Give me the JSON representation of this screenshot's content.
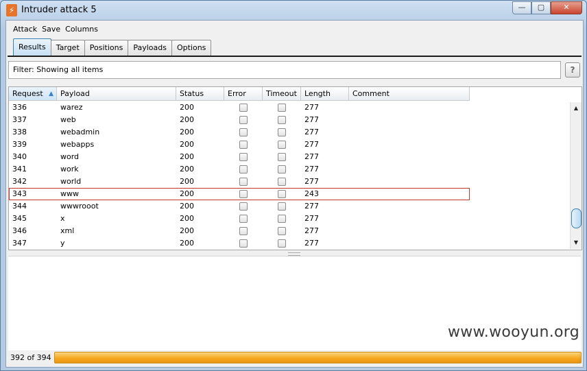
{
  "window": {
    "title": "Intruder attack 5",
    "minimize": "—",
    "maximize": "▢",
    "close": "✕"
  },
  "menu": [
    "Attack",
    "Save",
    "Columns"
  ],
  "tabs": [
    {
      "label": "Results",
      "active": true
    },
    {
      "label": "Target",
      "active": false
    },
    {
      "label": "Positions",
      "active": false
    },
    {
      "label": "Payloads",
      "active": false
    },
    {
      "label": "Options",
      "active": false
    }
  ],
  "filter": {
    "text": "Filter: Showing all items",
    "help": "?"
  },
  "table": {
    "columns": [
      "Request",
      "Payload",
      "Status",
      "Error",
      "Timeout",
      "Length",
      "Comment"
    ],
    "sort_indicator": "▲",
    "rows": [
      {
        "request": "336",
        "payload": "warez",
        "status": "200",
        "error": false,
        "timeout": false,
        "length": "277",
        "comment": "",
        "highlight": false
      },
      {
        "request": "337",
        "payload": "web",
        "status": "200",
        "error": false,
        "timeout": false,
        "length": "277",
        "comment": "",
        "highlight": false
      },
      {
        "request": "338",
        "payload": "webadmin",
        "status": "200",
        "error": false,
        "timeout": false,
        "length": "277",
        "comment": "",
        "highlight": false
      },
      {
        "request": "339",
        "payload": "webapps",
        "status": "200",
        "error": false,
        "timeout": false,
        "length": "277",
        "comment": "",
        "highlight": false
      },
      {
        "request": "340",
        "payload": "word",
        "status": "200",
        "error": false,
        "timeout": false,
        "length": "277",
        "comment": "",
        "highlight": false
      },
      {
        "request": "341",
        "payload": "work",
        "status": "200",
        "error": false,
        "timeout": false,
        "length": "277",
        "comment": "",
        "highlight": false
      },
      {
        "request": "342",
        "payload": "world",
        "status": "200",
        "error": false,
        "timeout": false,
        "length": "277",
        "comment": "",
        "highlight": false
      },
      {
        "request": "343",
        "payload": "www",
        "status": "200",
        "error": false,
        "timeout": false,
        "length": "243",
        "comment": "",
        "highlight": true
      },
      {
        "request": "344",
        "payload": "wwwrooot",
        "status": "200",
        "error": false,
        "timeout": false,
        "length": "277",
        "comment": "",
        "highlight": false
      },
      {
        "request": "345",
        "payload": "x",
        "status": "200",
        "error": false,
        "timeout": false,
        "length": "277",
        "comment": "",
        "highlight": false
      },
      {
        "request": "346",
        "payload": "xml",
        "status": "200",
        "error": false,
        "timeout": false,
        "length": "277",
        "comment": "",
        "highlight": false
      },
      {
        "request": "347",
        "payload": "y",
        "status": "200",
        "error": false,
        "timeout": false,
        "length": "277",
        "comment": "",
        "highlight": false
      }
    ]
  },
  "scrollbar": {
    "up": "▲",
    "down": "▼"
  },
  "progress": {
    "text": "392 of 394",
    "done": 392,
    "total": 394
  },
  "watermark": "www.wooyun.org",
  "colors": {
    "progress": "#f5a623",
    "highlight_border": "#c0392b",
    "active_tab": "#c7e0f4"
  }
}
